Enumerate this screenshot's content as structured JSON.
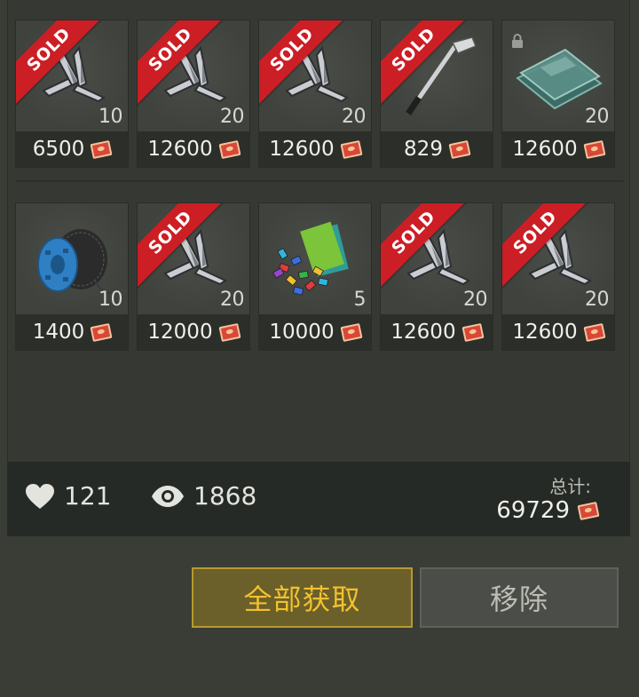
{
  "colors": {
    "background": "#3a3d36",
    "sold_ribbon": "#cc1e25",
    "primary_button_text": "#f2c12e",
    "primary_button_border": "#b79a30"
  },
  "items": [
    {
      "name": "metal-scrap",
      "quantity": "10",
      "price": "6500",
      "sold": true,
      "sold_label": "SOLD",
      "locked": false
    },
    {
      "name": "metal-scrap",
      "quantity": "20",
      "price": "12600",
      "sold": true,
      "sold_label": "SOLD",
      "locked": false
    },
    {
      "name": "metal-scrap",
      "quantity": "20",
      "price": "12600",
      "sold": true,
      "sold_label": "SOLD",
      "locked": false
    },
    {
      "name": "golf-club",
      "quantity": "",
      "price": "829",
      "sold": true,
      "sold_label": "SOLD",
      "locked": false
    },
    {
      "name": "glass-panes",
      "quantity": "20",
      "price": "12600",
      "sold": false,
      "locked": true
    },
    {
      "name": "wire-spool",
      "quantity": "10",
      "price": "1400",
      "sold": false,
      "locked": false
    },
    {
      "name": "metal-scrap",
      "quantity": "20",
      "price": "12000",
      "sold": true,
      "sold_label": "SOLD",
      "locked": false
    },
    {
      "name": "tinted-paper-beads",
      "quantity": "5",
      "price": "10000",
      "sold": false,
      "locked": false
    },
    {
      "name": "metal-scrap",
      "quantity": "20",
      "price": "12600",
      "sold": true,
      "sold_label": "SOLD",
      "locked": false
    },
    {
      "name": "metal-scrap",
      "quantity": "20",
      "price": "12600",
      "sold": true,
      "sold_label": "SOLD",
      "locked": false
    }
  ],
  "stats": {
    "likes": "121",
    "views": "1868",
    "total_label": "总计:",
    "total_value": "69729"
  },
  "buttons": {
    "collect_all": "全部获取",
    "remove": "移除"
  },
  "icons": {
    "currency": "coupon-icon",
    "like": "heart-icon",
    "view": "eye-icon",
    "lock": "lock-icon"
  }
}
